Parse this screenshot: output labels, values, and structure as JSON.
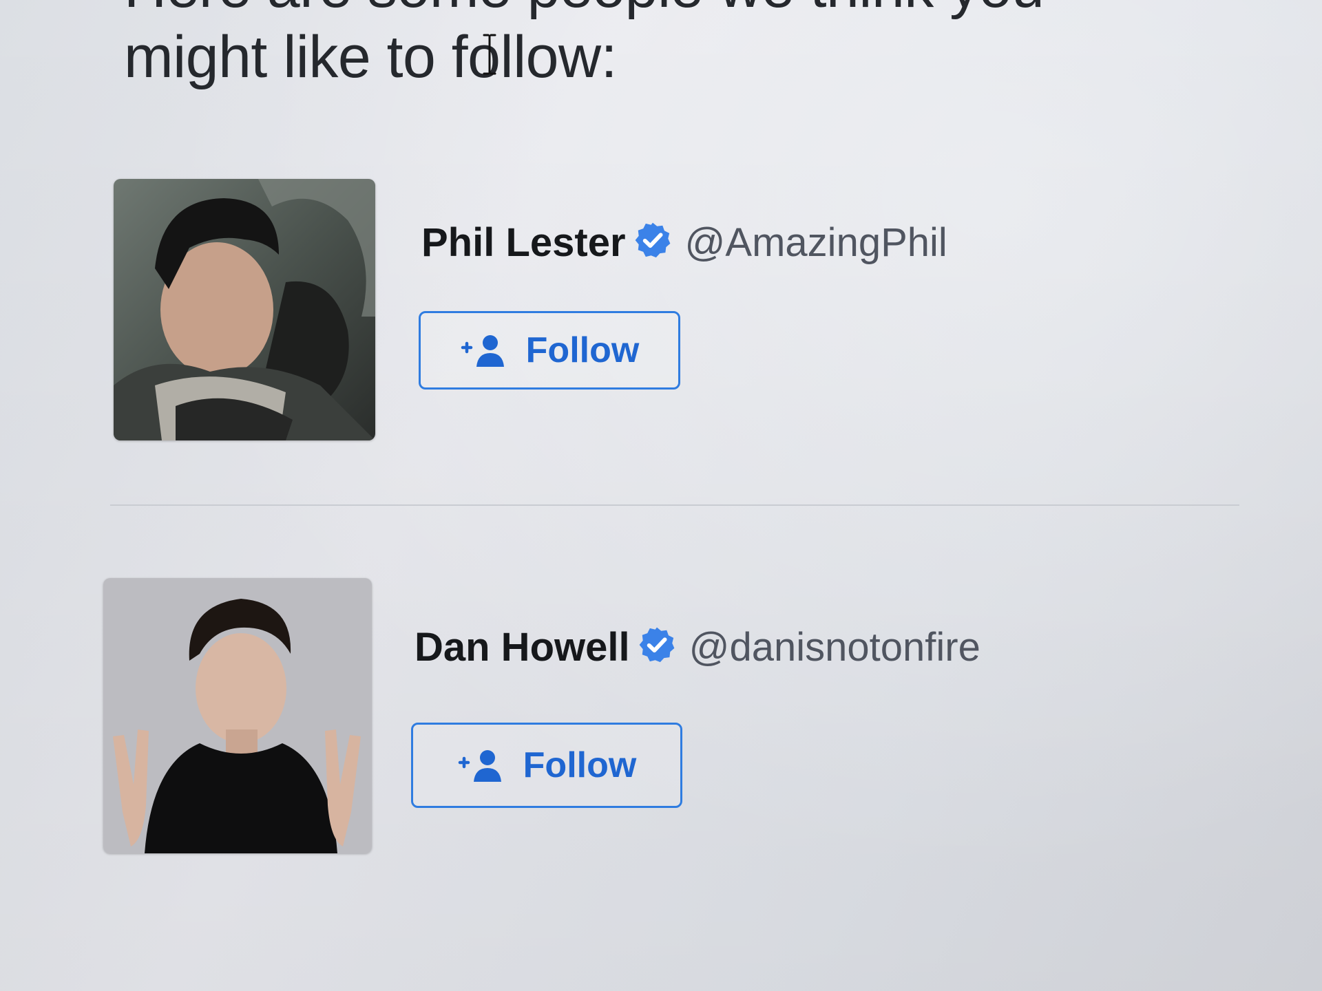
{
  "heading": {
    "line1": "Here are some people we think you",
    "line2": "might like to follow:"
  },
  "suggestions": [
    {
      "display_name": "Phil Lester",
      "handle": "@AmazingPhil",
      "verified": true,
      "follow_label": "Follow"
    },
    {
      "display_name": "Dan Howell",
      "handle": "@danisnotonfire",
      "verified": true,
      "follow_label": "Follow"
    }
  ],
  "colors": {
    "accent": "#1f66d1",
    "verified": "#3b82e8",
    "name_text": "#16181b",
    "handle_text": "#505560",
    "divider": "#c9ccd2"
  },
  "icons": {
    "verified": "verified-badge-icon",
    "follow": "add-user-icon",
    "cursor": "text-cursor-icon"
  }
}
